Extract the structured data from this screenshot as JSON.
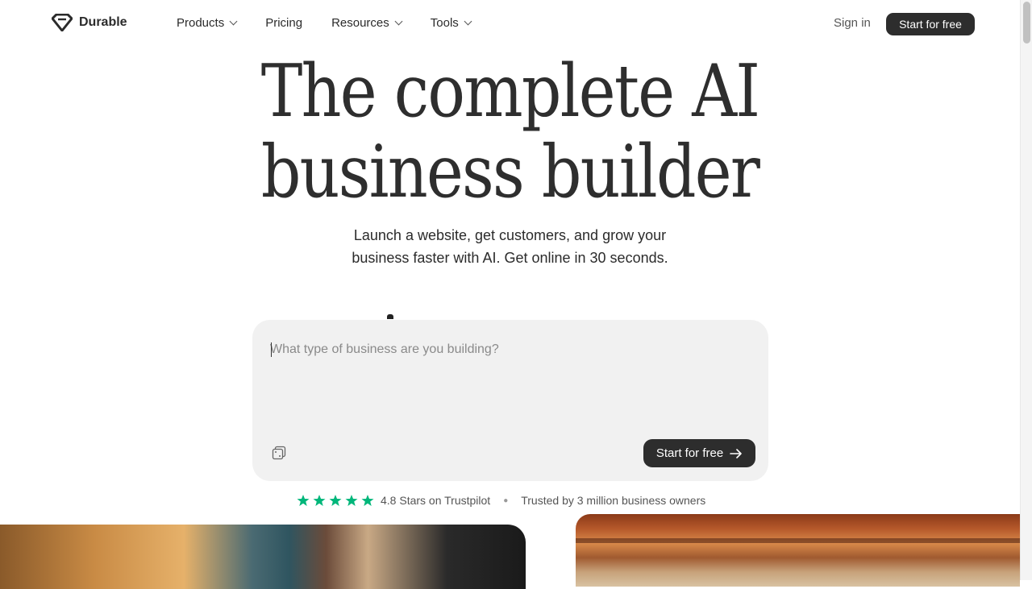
{
  "brand": {
    "name": "Durable"
  },
  "nav": {
    "links": [
      {
        "label": "Products",
        "has_dropdown": true
      },
      {
        "label": "Pricing",
        "has_dropdown": false
      },
      {
        "label": "Resources",
        "has_dropdown": true
      },
      {
        "label": "Tools",
        "has_dropdown": true
      }
    ],
    "signin_label": "Sign in",
    "cta_label": "Start for free"
  },
  "hero": {
    "headline_line1": "The complete AI",
    "headline_line2": "business builder",
    "subhead_line1": "Launch a website, get customers, and grow your",
    "subhead_line2": "business faster with AI. Get online in 30 seconds."
  },
  "prompt": {
    "placeholder": "What type of business are you building?",
    "value": "",
    "cta_label": "Start for free",
    "random_icon": "dice-icon",
    "arrow_icon": "arrow-right-icon"
  },
  "trust": {
    "stars": 5,
    "rating_text": "4.8 Stars on Trustpilot",
    "trusted_text": "Trusted by 3 million business owners",
    "star_color": "#00b67a"
  },
  "colors": {
    "button_bg": "#2d2d2d",
    "prompt_bg": "#f1f1f1"
  }
}
